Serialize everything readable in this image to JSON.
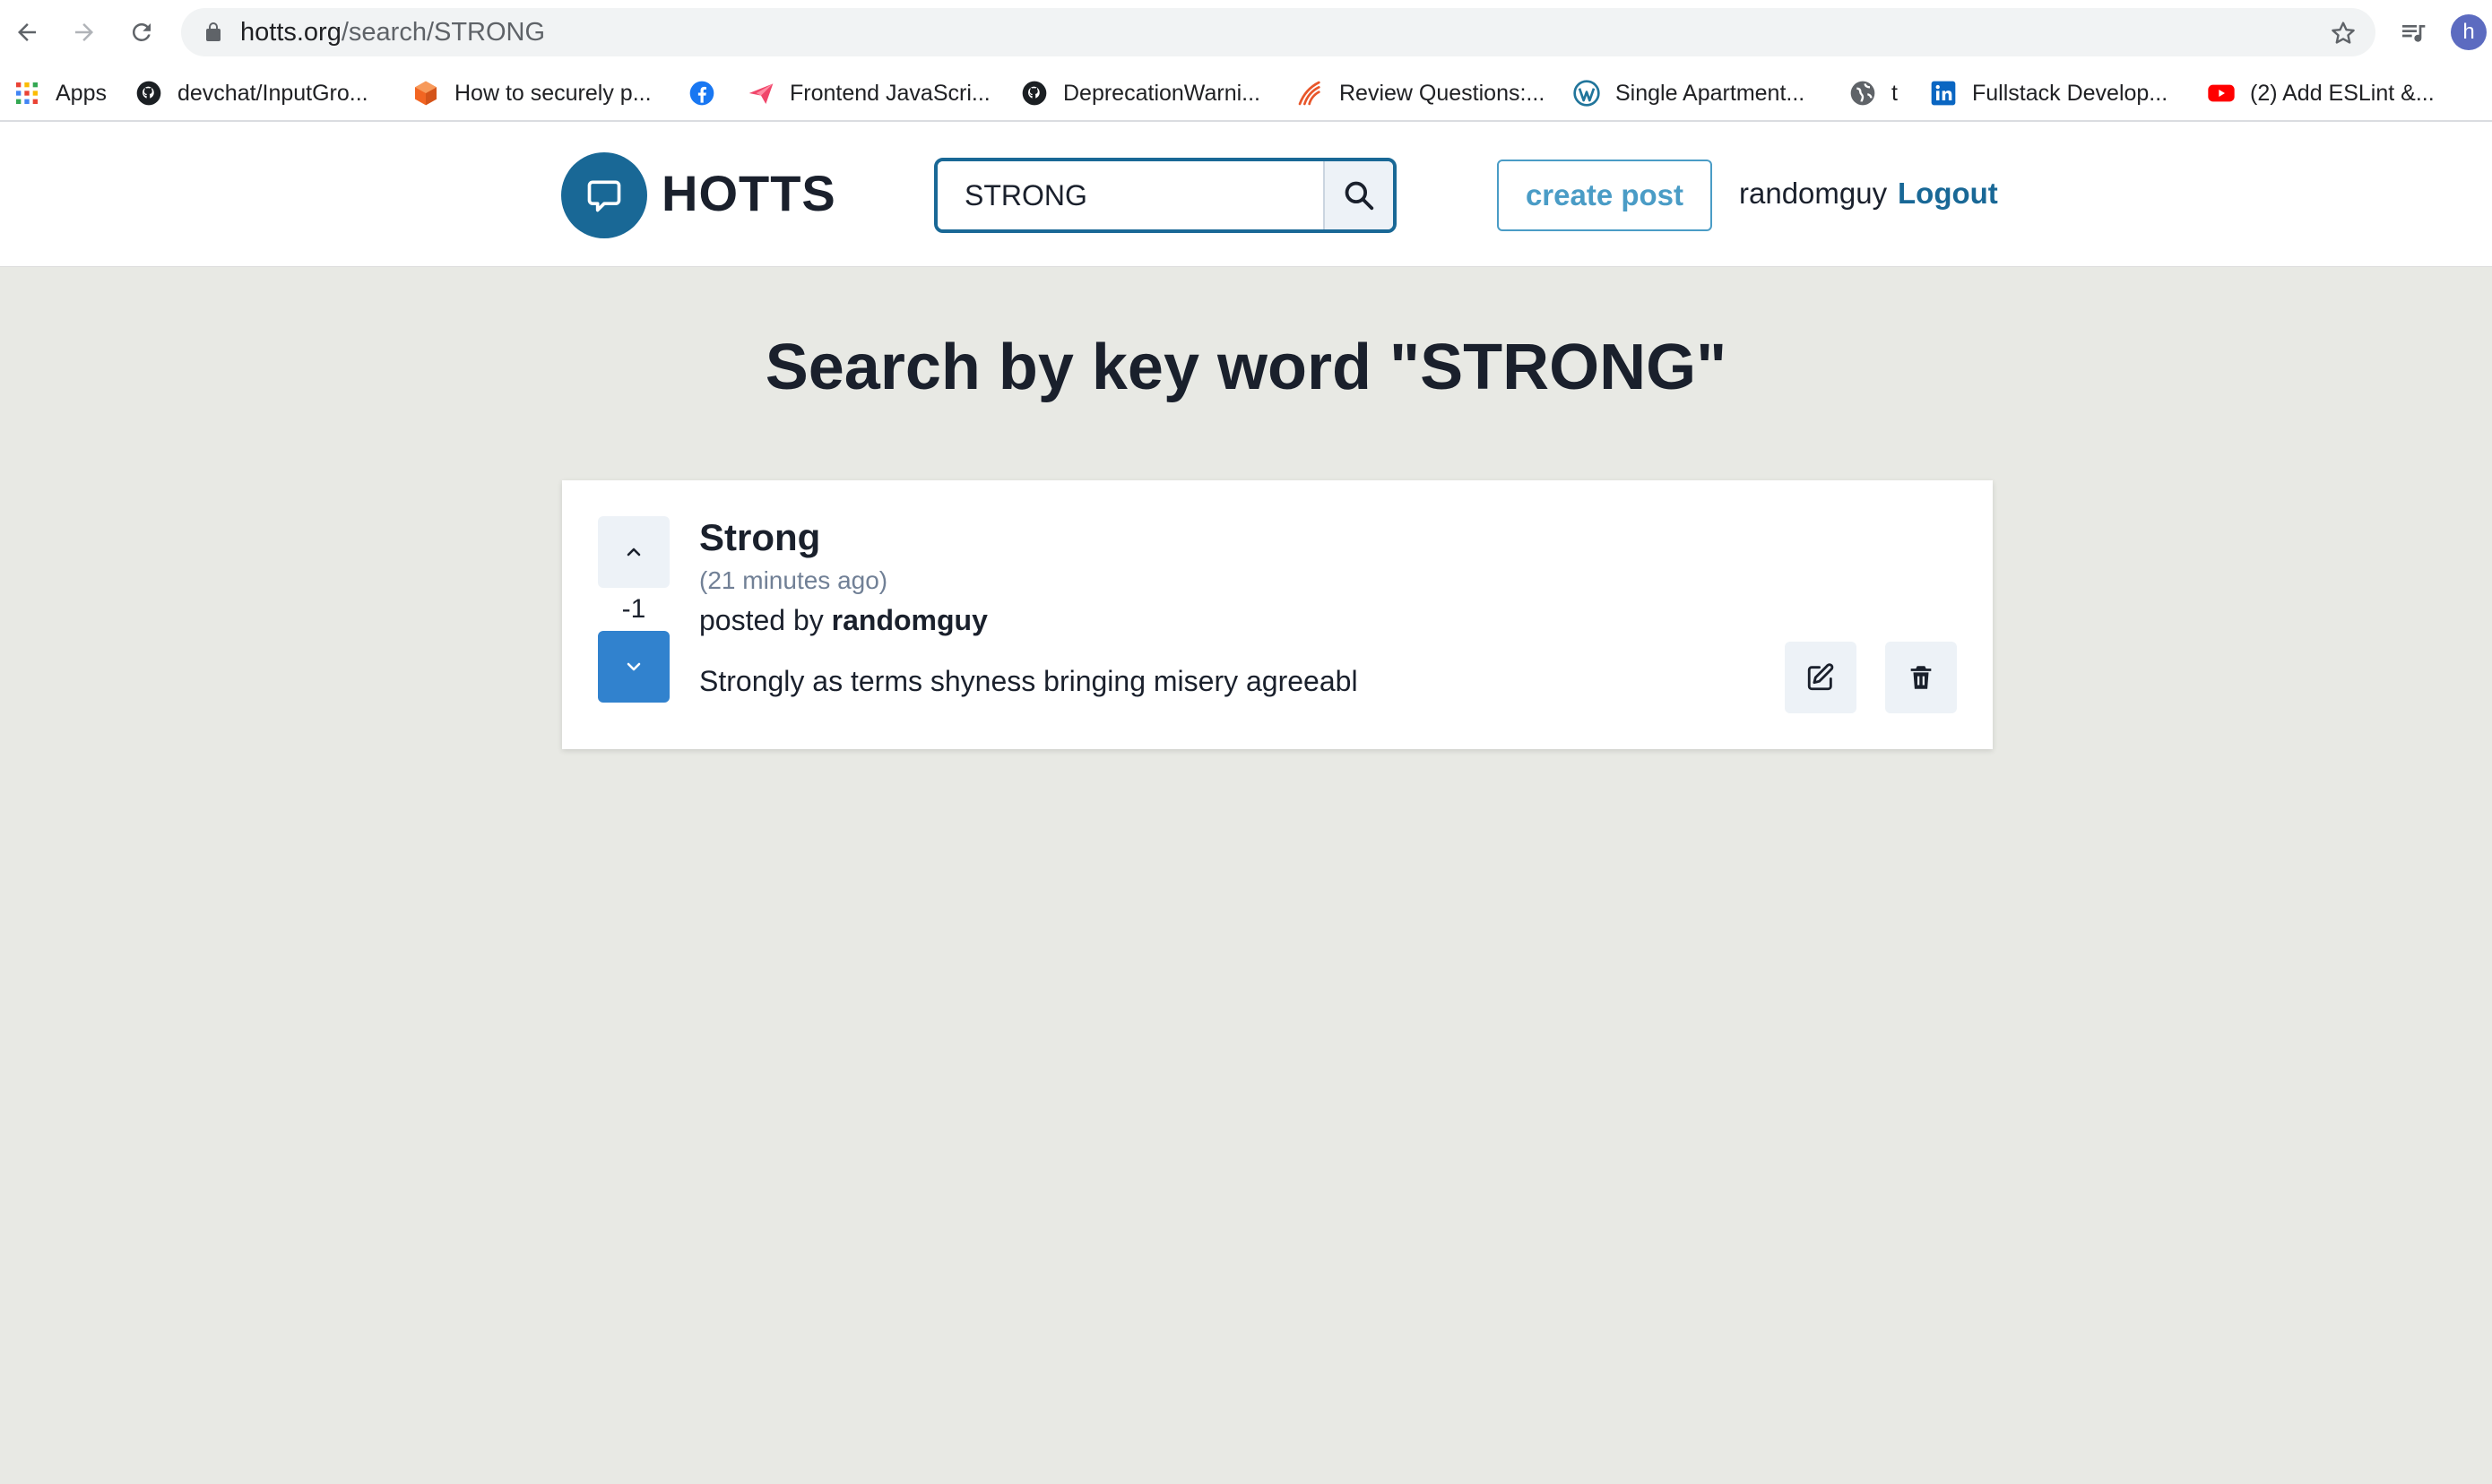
{
  "browser": {
    "url_domain": "hotts.org",
    "url_path": "/search/STRONG",
    "profile_initial": "h",
    "bookmarks": [
      {
        "label": "Apps",
        "icon": "apps-grid-icon"
      },
      {
        "label": "devchat/InputGro...",
        "icon": "github-icon"
      },
      {
        "label": "How to securely p...",
        "icon": "cube-icon"
      },
      {
        "label": "",
        "icon": "facebook-icon"
      },
      {
        "label": "Frontend JavaScri...",
        "icon": "paper-plane-icon"
      },
      {
        "label": "DeprecationWarni...",
        "icon": "github-icon"
      },
      {
        "label": "Review Questions:...",
        "icon": "quill-icon"
      },
      {
        "label": "Single Apartment...",
        "icon": "wordpress-icon"
      },
      {
        "label": "t",
        "icon": "globe-icon"
      },
      {
        "label": "Fullstack Develop...",
        "icon": "linkedin-icon"
      },
      {
        "label": "(2) Add ESLint &...",
        "icon": "youtube-icon"
      }
    ]
  },
  "header": {
    "logo_text": "HOTTS",
    "search_value": "STRONG",
    "create_post_label": "create post",
    "username": "randomguy",
    "logout_label": "Logout"
  },
  "main": {
    "title": "Search by key word \"STRONG\"",
    "posts": [
      {
        "title": "Strong",
        "time": "(21 minutes ago)",
        "posted_by_prefix": "posted by",
        "author": "randomguy",
        "body": "Strongly as terms shyness bringing misery agreeabl",
        "votes": "-1"
      }
    ]
  },
  "colors": {
    "brand": "#196896",
    "downvote_active": "#3182ce",
    "page_background": "#e8e9e4"
  }
}
